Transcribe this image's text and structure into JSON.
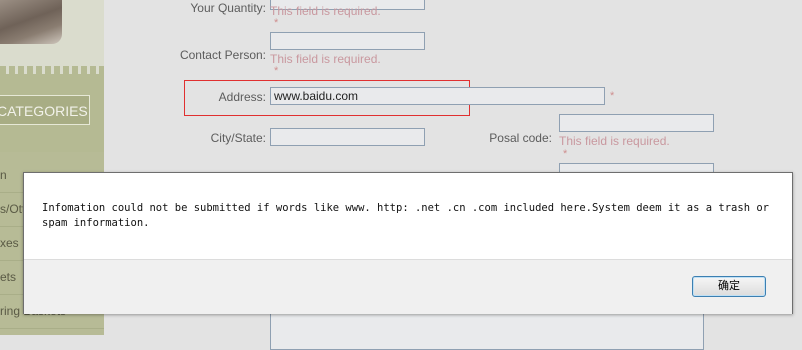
{
  "sidebar": {
    "categories_title": "CATEGORIES",
    "items": [
      "n",
      "s/Otto",
      "xes",
      "ets",
      "ring Baskets"
    ]
  },
  "form": {
    "quantity_label": "Your Quantity:",
    "quantity_error": "This field is required.",
    "contact_label": "Contact Person:",
    "contact_value": "",
    "contact_error": "This field is required.",
    "address_label": "Address:",
    "address_value": "www.baidu.com",
    "city_label": "City/State:",
    "city_value": "",
    "postal_label": "Posal code:",
    "postal_value": "",
    "postal_error": "This field is required.",
    "required_mark": "*"
  },
  "dialog": {
    "message": "Infomation could not be submitted if words like www. http: .net .cn .com included here.System deem it as a trash or spam information.",
    "ok_label": "确定"
  },
  "colors": {
    "highlight_border": "#e03030",
    "error_text": "#c9989f",
    "sidebar_band": "#b5ba93"
  }
}
